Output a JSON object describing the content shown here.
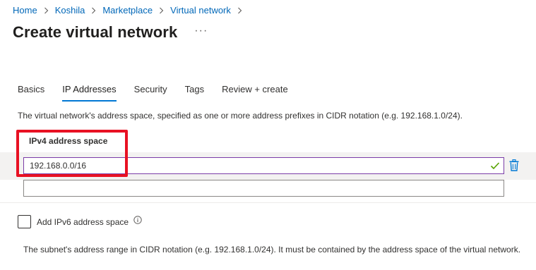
{
  "breadcrumb": [
    {
      "label": "Home"
    },
    {
      "label": "Koshila"
    },
    {
      "label": "Marketplace"
    },
    {
      "label": "Virtual network"
    }
  ],
  "page": {
    "title": "Create virtual network",
    "more_label": "···"
  },
  "tabs": [
    {
      "label": "Basics",
      "active": false
    },
    {
      "label": "IP Addresses",
      "active": true
    },
    {
      "label": "Security",
      "active": false
    },
    {
      "label": "Tags",
      "active": false
    },
    {
      "label": "Review + create",
      "active": false
    }
  ],
  "ip_section": {
    "description": "The virtual network's address space, specified as one or more address prefixes in CIDR notation (e.g. 192.168.1.0/24).",
    "ipv4_label": "IPv4 address space",
    "address_value": "192.168.0.0/16",
    "empty_value": ""
  },
  "ipv6": {
    "label": "Add IPv6 address space",
    "checked": false
  },
  "subnet": {
    "description": "The subnet's address range in CIDR notation (e.g. 192.168.1.0/24). It must be contained by the address space of the virtual network."
  },
  "icons": {
    "breadcrumb_separator": "chevron-right-icon",
    "valid": "checkmark-icon",
    "delete": "trash-icon",
    "info": "info-icon"
  },
  "colors": {
    "accent": "#0078d4",
    "link": "#0067b8",
    "highlight": "#e81123",
    "valid": "#57a300",
    "focus_border": "#7a3ca7"
  }
}
